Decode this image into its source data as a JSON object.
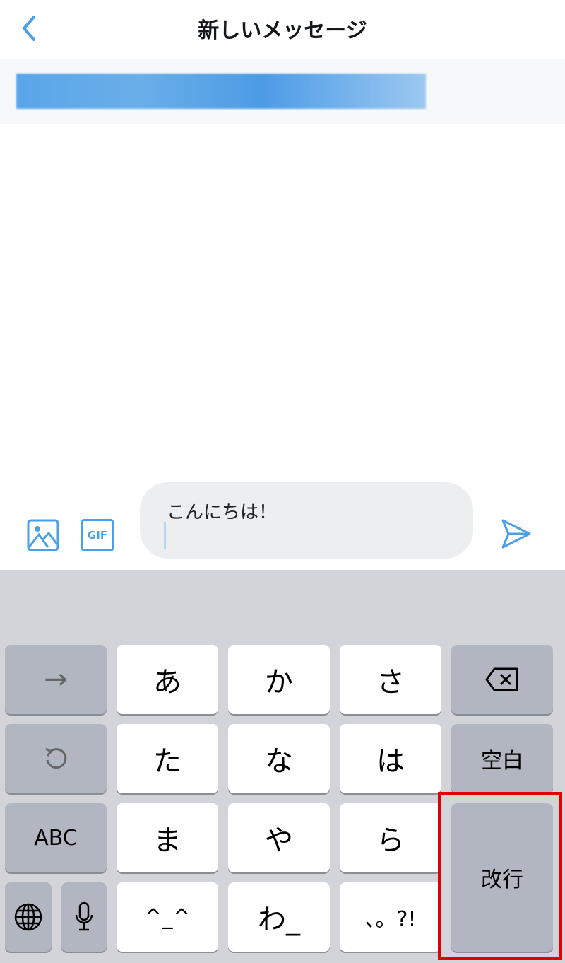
{
  "header": {
    "title": "新しいメッセージ",
    "back_icon": "chevron-left-icon"
  },
  "compose": {
    "message_text": "こんにちは！",
    "icons": [
      "image-icon",
      "gif-icon",
      "send-icon"
    ],
    "gif_label": "GIF"
  },
  "keyboard": {
    "rows": [
      [
        "→",
        "あ",
        "か",
        "さ",
        "⌫"
      ],
      [
        "↺",
        "た",
        "な",
        "は",
        "空白"
      ],
      [
        "ABC",
        "ま",
        "や",
        "ら",
        "改行"
      ],
      [
        "🌐",
        "🎤",
        "^^",
        "わ_",
        "、。?!"
      ]
    ],
    "keys": {
      "arrow": "→",
      "a": "あ",
      "ka": "か",
      "sa": "さ",
      "undo": "↺",
      "ta": "た",
      "na": "な",
      "ha": "は",
      "space": "空白",
      "abc": "ABC",
      "ma": "ま",
      "ya": "や",
      "ra": "ら",
      "return": "改行",
      "kaomoji": "^_^",
      "wa": "わ_",
      "punct": "、。?!"
    }
  },
  "colors": {
    "accent": "#4a9fe8",
    "highlight": "#e00000"
  }
}
